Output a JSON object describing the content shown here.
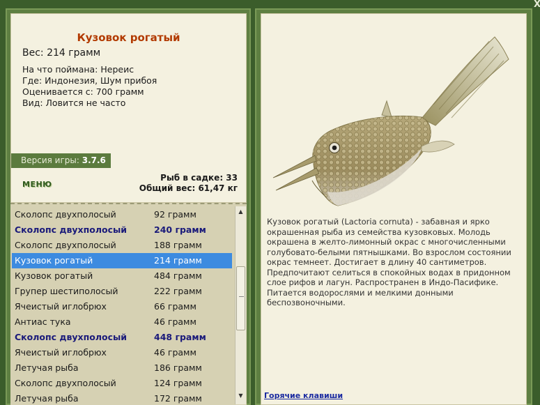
{
  "fish": {
    "title": "Кузовок рогатый",
    "weight_line": "Вес: 214 грамм",
    "details": [
      "На что поймана: Нереис",
      "Где: Индонезия, Шум прибоя",
      "Оценивается с: 700 грамм",
      "Вид: Ловится не часто"
    ],
    "description": "Кузовок рогатый (Lactoria cornuta) - забавная и ярко окрашенная рыба из семейства кузовковых. Молодь окрашена в желто-лимонный окрас с многочисленными голубовато-белыми пятнышками. Во взрослом состоянии окрас темнеет. Достигает в длину 40 сантиметров. Предпочитают селиться в спокойных водах в придонном слое рифов и лагун. Распространен в Индо-Пасифике. Питается водорослями и мелкими донными беспозвоночными."
  },
  "version": {
    "label": "Версия игры:",
    "value": "3.7.6"
  },
  "menu_label": "МЕНЮ",
  "stats": {
    "keep_net": "Рыб в садке: 33",
    "total_weight": "Общий вес: 61,47 кг"
  },
  "catch_list": [
    {
      "name": "Сколопс двухполосый",
      "weight": "92 грамм",
      "style": "normal"
    },
    {
      "name": "Сколопс двухполосый",
      "weight": "240 грамм",
      "style": "bold"
    },
    {
      "name": "Сколопс двухполосый",
      "weight": "188 грамм",
      "style": "normal"
    },
    {
      "name": "Кузовок рогатый",
      "weight": "214 грамм",
      "style": "selected"
    },
    {
      "name": "Кузовок рогатый",
      "weight": "484 грамм",
      "style": "normal"
    },
    {
      "name": "Групер шестиполосый",
      "weight": "222 грамм",
      "style": "normal"
    },
    {
      "name": "Ячеистый иглобрюх",
      "weight": "66 грамм",
      "style": "normal"
    },
    {
      "name": "Антиас тука",
      "weight": "46 грамм",
      "style": "normal"
    },
    {
      "name": "Сколопс двухполосый",
      "weight": "448 грамм",
      "style": "bold"
    },
    {
      "name": "Ячеистый иглобрюх",
      "weight": "46 грамм",
      "style": "normal"
    },
    {
      "name": "Летучая рыба",
      "weight": "186 грамм",
      "style": "normal"
    },
    {
      "name": "Сколопс двухполосый",
      "weight": "124 грамм",
      "style": "normal"
    },
    {
      "name": "Летучая рыба",
      "weight": "172 грамм",
      "style": "normal"
    }
  ],
  "hotkeys_label": "Горячие клавиши",
  "close_label": "X",
  "colors": {
    "title": "#b23a00",
    "selected_row": "#3d8be0",
    "bold_row": "#1a1a7a",
    "panel_bg": "#f4f1e0",
    "list_bg": "#d6d1b3",
    "frame": "#5e7f42"
  }
}
